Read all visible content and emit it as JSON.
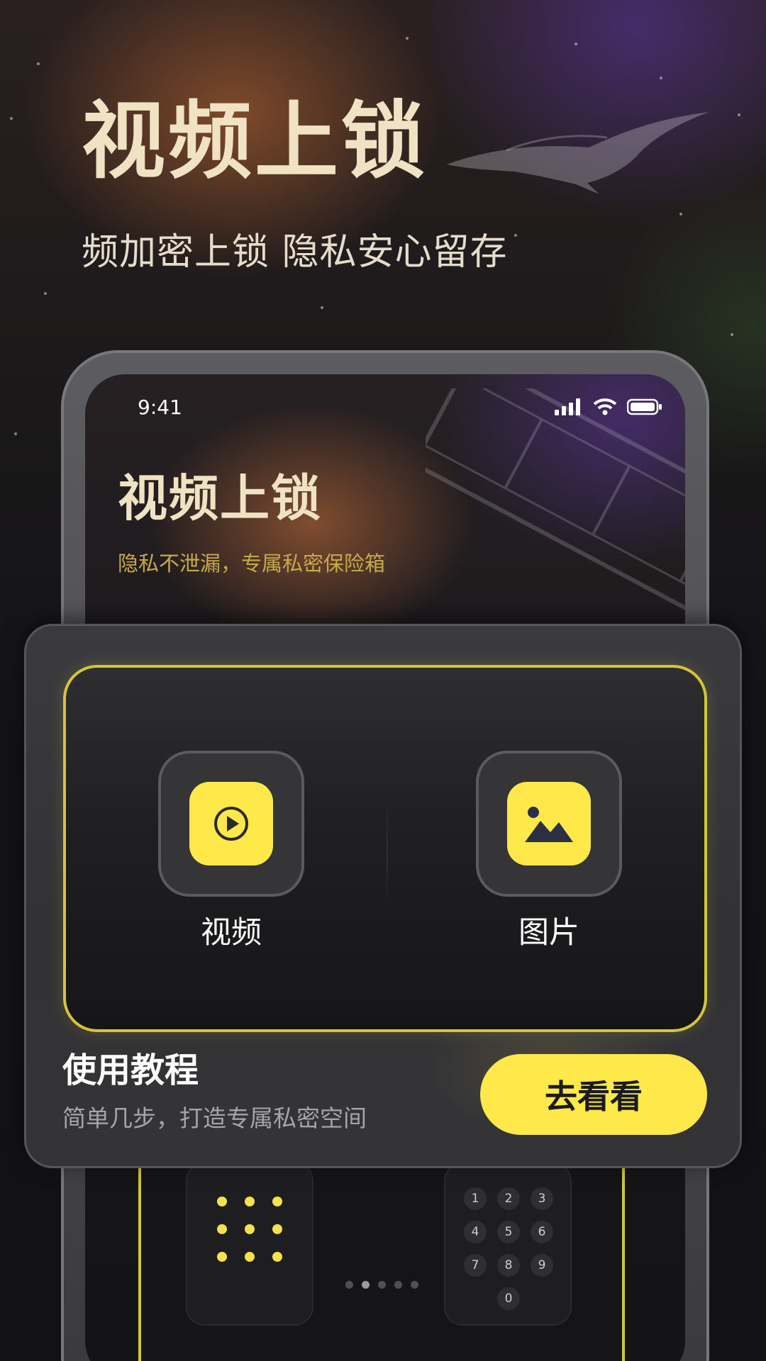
{
  "hero": {
    "title": "视频上锁",
    "subtitle": "频加密上锁 隐私安心留存"
  },
  "phone": {
    "status_time": "9:41",
    "title": "视频上锁",
    "subtitle": "隐私不泄漏，专属私密保险箱"
  },
  "card": {
    "options": [
      {
        "label": "视频",
        "icon": "play-icon"
      },
      {
        "label": "图片",
        "icon": "image-icon"
      }
    ],
    "tutorial_title": "使用教程",
    "tutorial_subtitle": "简单几步，打造专属私密空间",
    "cta_label": "去看看"
  },
  "keypad": {
    "keys": [
      "1",
      "2",
      "3",
      "4",
      "5",
      "6",
      "7",
      "8",
      "9",
      "0"
    ]
  },
  "pagination": {
    "total": 5,
    "active_index": 1
  },
  "colors": {
    "accent": "#ffe84a",
    "hero_text": "#efe3c4",
    "subtitle_gold": "#c7a94e",
    "frame_border": "#d4c43a"
  }
}
